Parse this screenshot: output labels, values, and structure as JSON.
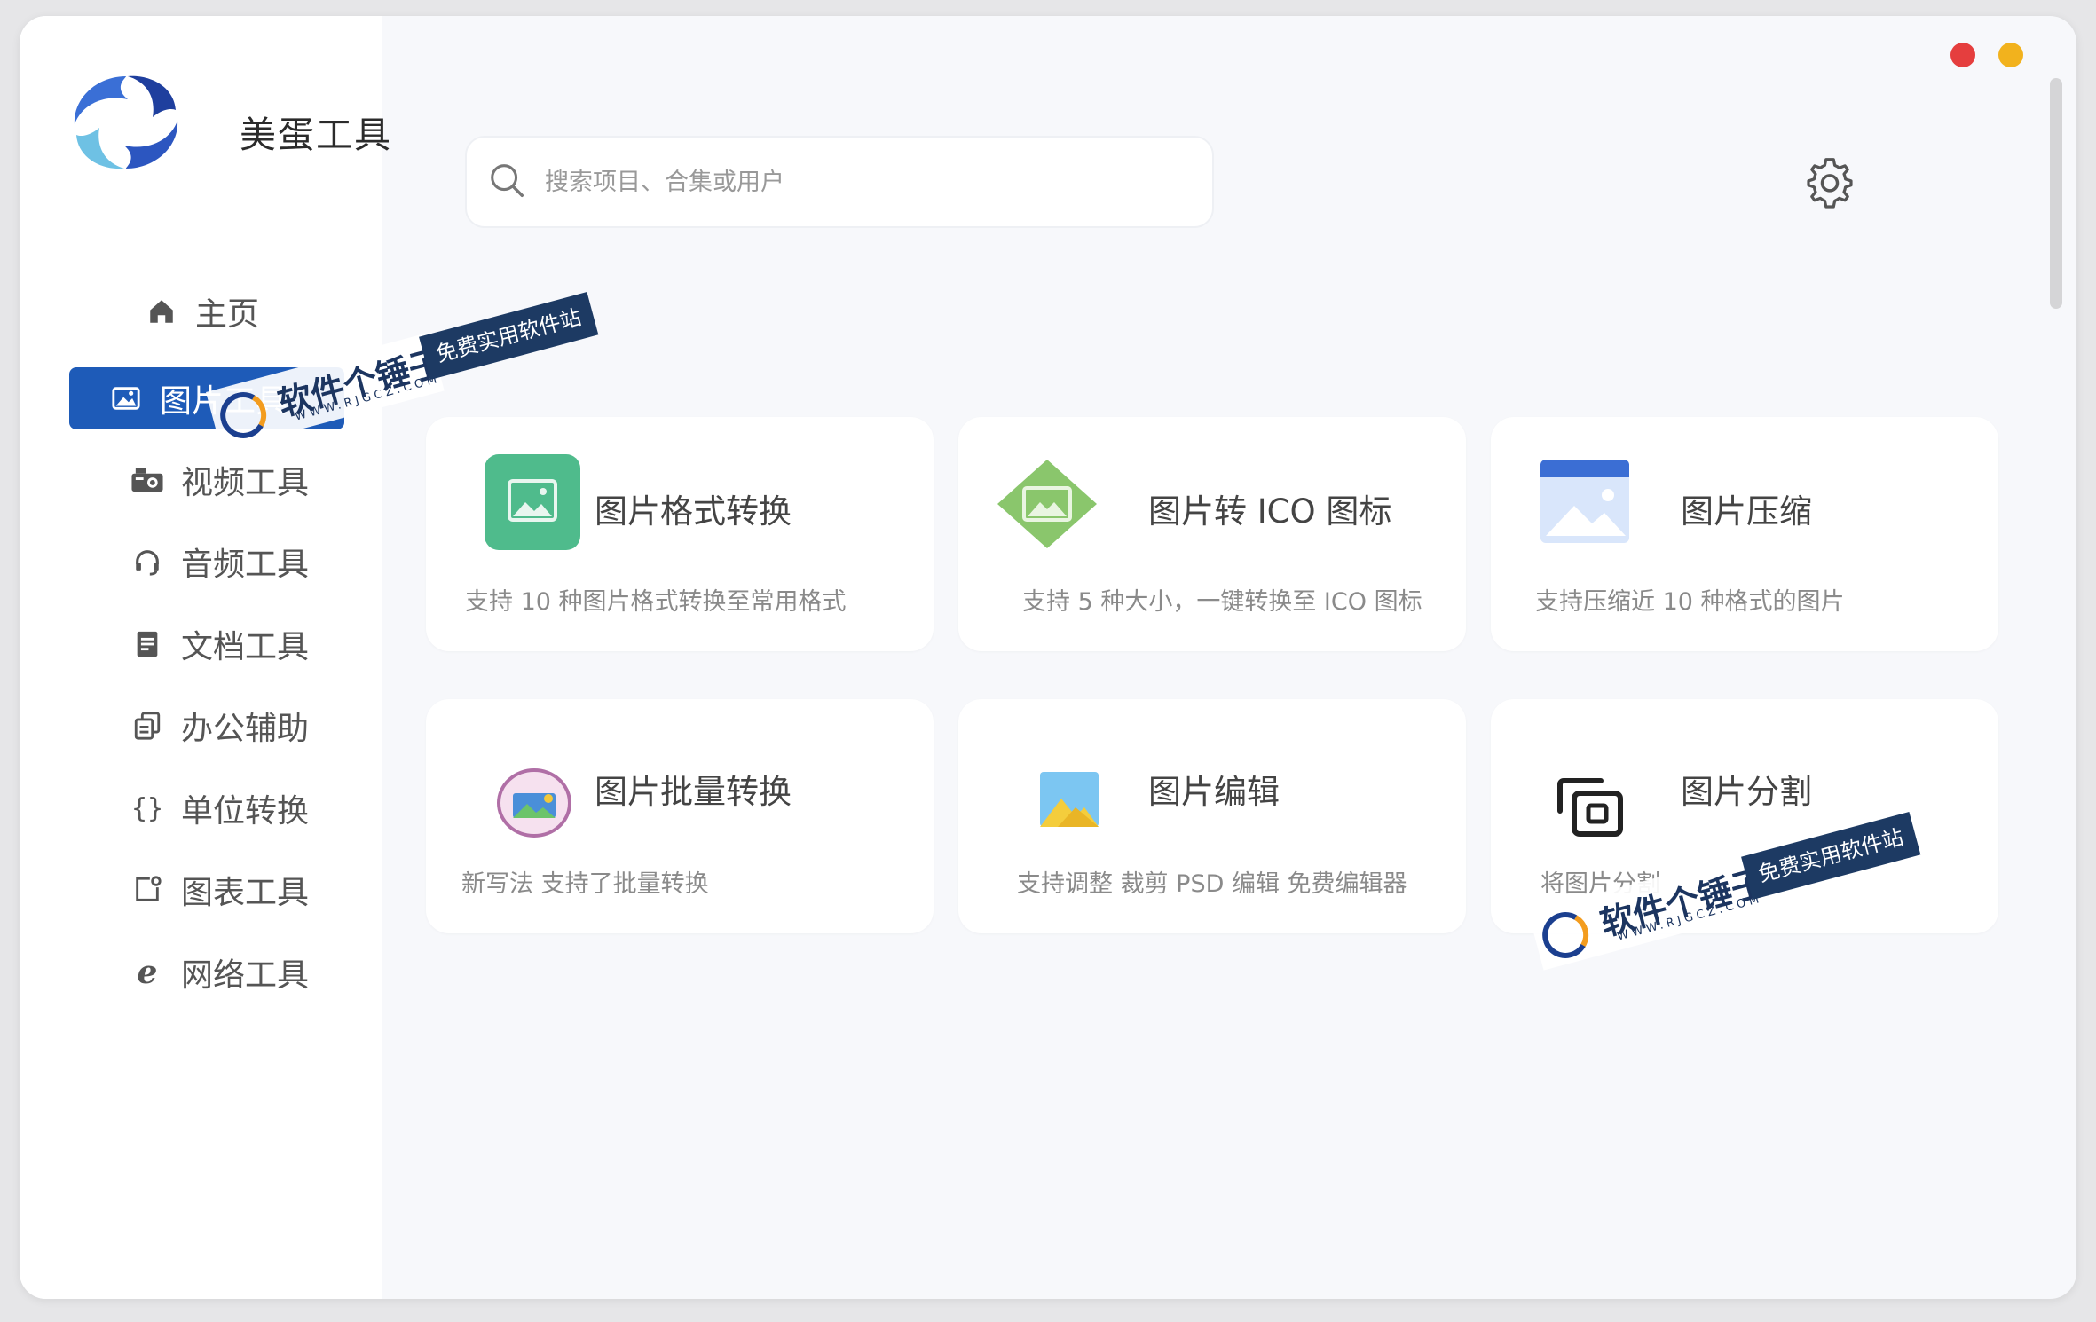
{
  "app": {
    "name": "美蛋工具"
  },
  "sidebar": {
    "items": [
      {
        "label": "主页",
        "icon": "home-icon"
      },
      {
        "label": "图片工具",
        "icon": "image-icon",
        "active": true
      },
      {
        "label": "视频工具",
        "icon": "video-icon"
      },
      {
        "label": "音频工具",
        "icon": "headset-icon"
      },
      {
        "label": "文档工具",
        "icon": "document-icon"
      },
      {
        "label": "办公辅助",
        "icon": "copy-icon"
      },
      {
        "label": "单位转换",
        "icon": "braces-icon"
      },
      {
        "label": "图表工具",
        "icon": "chart-icon"
      },
      {
        "label": "网络工具",
        "icon": "ie-icon"
      }
    ]
  },
  "search": {
    "placeholder": "搜索项目、合集或用户"
  },
  "cards": [
    {
      "title": "图片格式转换",
      "desc": "支持 10 种图片格式转换至常用格式",
      "icon": "image-format-icon"
    },
    {
      "title": "图片转 ICO 图标",
      "desc": "支持 5 种大小，一键转换至 ICO 图标",
      "icon": "ico-convert-icon"
    },
    {
      "title": "图片压缩",
      "desc": "支持压缩近 10 种格式的图片",
      "icon": "image-compress-icon"
    },
    {
      "title": "图片批量转换",
      "desc": "新写法 支持了批量转换",
      "icon": "batch-convert-icon"
    },
    {
      "title": "图片编辑",
      "desc": "支持调整 裁剪 PSD 编辑  免费编辑器",
      "icon": "image-edit-icon"
    },
    {
      "title": "图片分割",
      "desc": "将图片分割",
      "icon": "image-split-icon"
    }
  ],
  "watermark": {
    "name": "软件个锤子",
    "url": "WWW.RJGCZ.COM",
    "slogan": "免费实用软件站"
  },
  "colors": {
    "accent": "#1e5bb8",
    "close": "#e53e3e",
    "minimize": "#f2b21d"
  }
}
